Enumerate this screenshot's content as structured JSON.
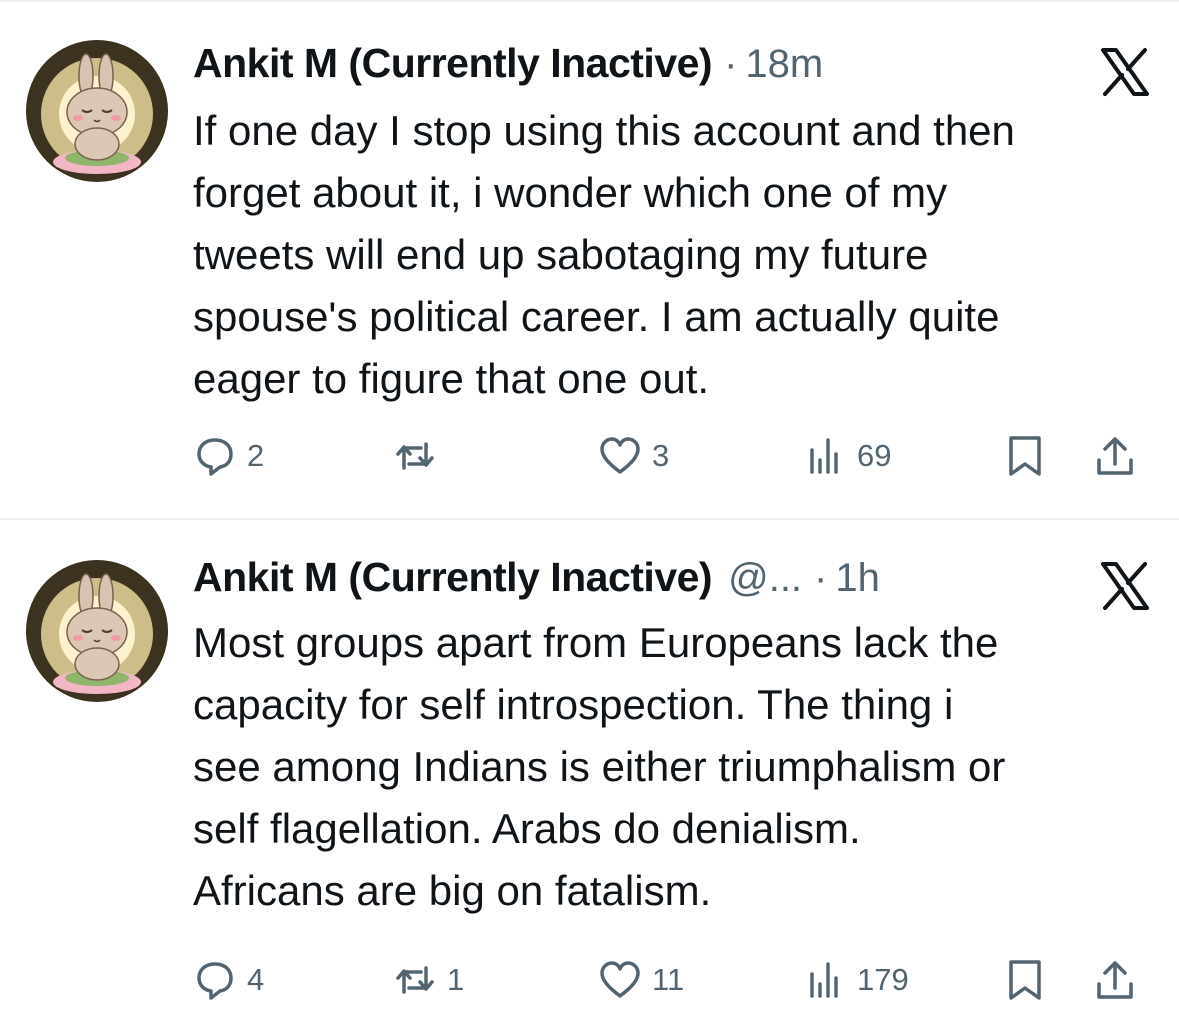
{
  "tweets": [
    {
      "author": "Ankit M (Currently Inactive)",
      "handle": "",
      "separator": "·",
      "time": "18m",
      "text_lines": [
        "If one day I stop using this account and then",
        "forget about it, i wonder which one of my",
        "tweets will end up sabotaging my future",
        "spouse's political career. I am actually quite",
        "eager to figure that one out."
      ],
      "replies": "2",
      "retweets": "",
      "likes": "3",
      "views": "69"
    },
    {
      "author": "Ankit M (Currently Inactive)",
      "handle": "@...",
      "separator": "·",
      "time": "1h",
      "text_lines": [
        "Most groups apart from Europeans lack the",
        "capacity for self introspection. The thing i",
        "see among Indians is either triumphalism or",
        "self flagellation. Arabs do denialism.",
        "Africans are big on fatalism."
      ],
      "replies": "4",
      "retweets": "1",
      "likes": "11",
      "views": "179"
    }
  ],
  "icons": {
    "reply": "reply-icon",
    "retweet": "retweet-icon",
    "like": "heart-icon",
    "views": "views-icon",
    "bookmark": "bookmark-icon",
    "share": "share-icon",
    "platform": "x-logo-icon"
  },
  "colors": {
    "text": "#0f1419",
    "secondary": "#536471",
    "divider": "#eff3f4"
  }
}
